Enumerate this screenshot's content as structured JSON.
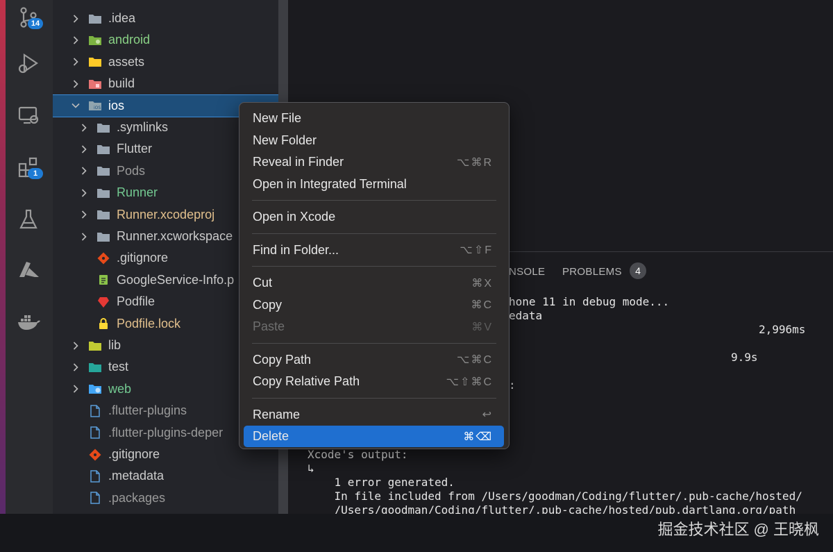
{
  "activity_bar": {
    "items": [
      {
        "icon": "source-control-icon",
        "badge": "14"
      },
      {
        "icon": "run-debug-icon",
        "badge": ""
      },
      {
        "icon": "remote-explorer-icon",
        "badge": ""
      },
      {
        "icon": "extensions-icon",
        "badge": "1"
      },
      {
        "icon": "testing-flask-icon",
        "badge": ""
      },
      {
        "icon": "azure-icon",
        "badge": ""
      },
      {
        "icon": "docker-icon",
        "badge": ""
      }
    ]
  },
  "explorer": {
    "rows": [
      {
        "label": ".idea",
        "icon": "folder-icon",
        "color": "#cccccc",
        "indent": 0,
        "expanded": false,
        "folder": true
      },
      {
        "label": "android",
        "icon": "android-folder-icon",
        "color": "#89d185",
        "indent": 0,
        "expanded": false,
        "folder": true,
        "modified": true
      },
      {
        "label": "assets",
        "icon": "assets-folder-icon",
        "color": "#cccccc",
        "indent": 0,
        "expanded": false,
        "folder": true
      },
      {
        "label": "build",
        "icon": "build-folder-icon",
        "color": "#cccccc",
        "indent": 0,
        "expanded": false,
        "folder": true
      },
      {
        "label": "ios",
        "icon": "ios-folder-icon",
        "color": "#ffffff",
        "indent": 0,
        "expanded": true,
        "folder": true,
        "selected": true
      },
      {
        "label": ".symlinks",
        "icon": "folder-icon",
        "color": "#cccccc",
        "indent": 1,
        "expanded": false,
        "folder": true
      },
      {
        "label": "Flutter",
        "icon": "folder-icon",
        "color": "#cccccc",
        "indent": 1,
        "expanded": false,
        "folder": true
      },
      {
        "label": "Pods",
        "icon": "folder-icon",
        "color": "#9a9a9a",
        "indent": 1,
        "expanded": false,
        "folder": true
      },
      {
        "label": "Runner",
        "icon": "folder-icon",
        "color": "#73c991",
        "indent": 1,
        "expanded": false,
        "folder": true
      },
      {
        "label": "Runner.xcodeproj",
        "icon": "folder-icon",
        "color": "#e2c08d",
        "indent": 1,
        "expanded": false,
        "folder": true
      },
      {
        "label": "Runner.xcworkspace",
        "icon": "folder-icon",
        "color": "#cccccc",
        "indent": 1,
        "expanded": false,
        "folder": true
      },
      {
        "label": ".gitignore",
        "icon": "git-icon",
        "color": "#cccccc",
        "indent": 1,
        "folder": false
      },
      {
        "label": "GoogleService-Info.p",
        "icon": "plist-icon",
        "color": "#cccccc",
        "indent": 1,
        "folder": false
      },
      {
        "label": "Podfile",
        "icon": "ruby-icon",
        "color": "#cccccc",
        "indent": 1,
        "folder": false
      },
      {
        "label": "Podfile.lock",
        "icon": "lock-icon",
        "color": "#e2c08d",
        "indent": 1,
        "folder": false
      },
      {
        "label": "lib",
        "icon": "lib-folder-icon",
        "color": "#cccccc",
        "indent": 0,
        "expanded": false,
        "folder": true
      },
      {
        "label": "test",
        "icon": "test-folder-icon",
        "color": "#cccccc",
        "indent": 0,
        "expanded": false,
        "folder": true
      },
      {
        "label": "web",
        "icon": "web-folder-icon",
        "color": "#73c991",
        "indent": 0,
        "expanded": false,
        "folder": true
      },
      {
        "label": ".flutter-plugins",
        "icon": "file-icon",
        "color": "#9a9a9a",
        "indent": 0,
        "folder": false
      },
      {
        "label": ".flutter-plugins-deper",
        "icon": "file-icon",
        "color": "#9a9a9a",
        "indent": 0,
        "folder": false
      },
      {
        "label": ".gitignore",
        "icon": "git-icon",
        "color": "#cccccc",
        "indent": 0,
        "folder": false
      },
      {
        "label": ".metadata",
        "icon": "file-icon",
        "color": "#cccccc",
        "indent": 0,
        "folder": false
      },
      {
        "label": ".packages",
        "icon": "file-icon",
        "color": "#9a9a9a",
        "indent": 0,
        "folder": false
      }
    ]
  },
  "context_menu": {
    "groups": [
      [
        {
          "label": "New File",
          "shortcut": ""
        },
        {
          "label": "New Folder",
          "shortcut": ""
        },
        {
          "label": "Reveal in Finder",
          "shortcut": "⌥⌘R"
        },
        {
          "label": "Open in Integrated Terminal",
          "shortcut": ""
        }
      ],
      [
        {
          "label": "Open in Xcode",
          "shortcut": ""
        }
      ],
      [
        {
          "label": "Find in Folder...",
          "shortcut": "⌥⇧F"
        }
      ],
      [
        {
          "label": "Cut",
          "shortcut": "⌘X"
        },
        {
          "label": "Copy",
          "shortcut": "⌘C"
        },
        {
          "label": "Paste",
          "shortcut": "⌘V",
          "disabled": true
        }
      ],
      [
        {
          "label": "Copy Path",
          "shortcut": "⌥⌘C"
        },
        {
          "label": "Copy Relative Path",
          "shortcut": "⌥⇧⌘C"
        }
      ],
      [
        {
          "label": "Rename",
          "shortcut": "↩"
        },
        {
          "label": "Delete",
          "shortcut": "⌘⌫",
          "active": true
        }
      ]
    ]
  },
  "panel": {
    "tabs": [
      {
        "label": "NSOLE"
      },
      {
        "label": "PROBLEMS",
        "badge": "4"
      }
    ],
    "terminal_lines": [
      "hone 11 in debug mode...",
      "edata",
      "2,996ms",
      "9.9s",
      ":",
      "Xcode's output:",
      "↳",
      "    1 error generated.",
      "    In file included from /Users/goodman/Coding/flutter/.pub-cache/hosted/",
      "    /Users/goodman/Coding/flutter/.pub-cache/hosted/pub.dartlang.org/path"
    ]
  },
  "watermark": "掘金技术社区 @ 王晓枫"
}
